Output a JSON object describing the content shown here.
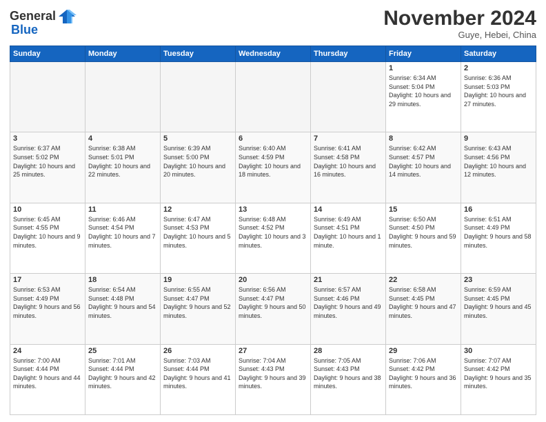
{
  "logo": {
    "general": "General",
    "blue": "Blue"
  },
  "header": {
    "month": "November 2024",
    "location": "Guye, Hebei, China"
  },
  "weekdays": [
    "Sunday",
    "Monday",
    "Tuesday",
    "Wednesday",
    "Thursday",
    "Friday",
    "Saturday"
  ],
  "weeks": [
    [
      {
        "day": "",
        "info": ""
      },
      {
        "day": "",
        "info": ""
      },
      {
        "day": "",
        "info": ""
      },
      {
        "day": "",
        "info": ""
      },
      {
        "day": "",
        "info": ""
      },
      {
        "day": "1",
        "info": "Sunrise: 6:34 AM\nSunset: 5:04 PM\nDaylight: 10 hours and 29 minutes."
      },
      {
        "day": "2",
        "info": "Sunrise: 6:36 AM\nSunset: 5:03 PM\nDaylight: 10 hours and 27 minutes."
      }
    ],
    [
      {
        "day": "3",
        "info": "Sunrise: 6:37 AM\nSunset: 5:02 PM\nDaylight: 10 hours and 25 minutes."
      },
      {
        "day": "4",
        "info": "Sunrise: 6:38 AM\nSunset: 5:01 PM\nDaylight: 10 hours and 22 minutes."
      },
      {
        "day": "5",
        "info": "Sunrise: 6:39 AM\nSunset: 5:00 PM\nDaylight: 10 hours and 20 minutes."
      },
      {
        "day": "6",
        "info": "Sunrise: 6:40 AM\nSunset: 4:59 PM\nDaylight: 10 hours and 18 minutes."
      },
      {
        "day": "7",
        "info": "Sunrise: 6:41 AM\nSunset: 4:58 PM\nDaylight: 10 hours and 16 minutes."
      },
      {
        "day": "8",
        "info": "Sunrise: 6:42 AM\nSunset: 4:57 PM\nDaylight: 10 hours and 14 minutes."
      },
      {
        "day": "9",
        "info": "Sunrise: 6:43 AM\nSunset: 4:56 PM\nDaylight: 10 hours and 12 minutes."
      }
    ],
    [
      {
        "day": "10",
        "info": "Sunrise: 6:45 AM\nSunset: 4:55 PM\nDaylight: 10 hours and 9 minutes."
      },
      {
        "day": "11",
        "info": "Sunrise: 6:46 AM\nSunset: 4:54 PM\nDaylight: 10 hours and 7 minutes."
      },
      {
        "day": "12",
        "info": "Sunrise: 6:47 AM\nSunset: 4:53 PM\nDaylight: 10 hours and 5 minutes."
      },
      {
        "day": "13",
        "info": "Sunrise: 6:48 AM\nSunset: 4:52 PM\nDaylight: 10 hours and 3 minutes."
      },
      {
        "day": "14",
        "info": "Sunrise: 6:49 AM\nSunset: 4:51 PM\nDaylight: 10 hours and 1 minute."
      },
      {
        "day": "15",
        "info": "Sunrise: 6:50 AM\nSunset: 4:50 PM\nDaylight: 9 hours and 59 minutes."
      },
      {
        "day": "16",
        "info": "Sunrise: 6:51 AM\nSunset: 4:49 PM\nDaylight: 9 hours and 58 minutes."
      }
    ],
    [
      {
        "day": "17",
        "info": "Sunrise: 6:53 AM\nSunset: 4:49 PM\nDaylight: 9 hours and 56 minutes."
      },
      {
        "day": "18",
        "info": "Sunrise: 6:54 AM\nSunset: 4:48 PM\nDaylight: 9 hours and 54 minutes."
      },
      {
        "day": "19",
        "info": "Sunrise: 6:55 AM\nSunset: 4:47 PM\nDaylight: 9 hours and 52 minutes."
      },
      {
        "day": "20",
        "info": "Sunrise: 6:56 AM\nSunset: 4:47 PM\nDaylight: 9 hours and 50 minutes."
      },
      {
        "day": "21",
        "info": "Sunrise: 6:57 AM\nSunset: 4:46 PM\nDaylight: 9 hours and 49 minutes."
      },
      {
        "day": "22",
        "info": "Sunrise: 6:58 AM\nSunset: 4:45 PM\nDaylight: 9 hours and 47 minutes."
      },
      {
        "day": "23",
        "info": "Sunrise: 6:59 AM\nSunset: 4:45 PM\nDaylight: 9 hours and 45 minutes."
      }
    ],
    [
      {
        "day": "24",
        "info": "Sunrise: 7:00 AM\nSunset: 4:44 PM\nDaylight: 9 hours and 44 minutes."
      },
      {
        "day": "25",
        "info": "Sunrise: 7:01 AM\nSunset: 4:44 PM\nDaylight: 9 hours and 42 minutes."
      },
      {
        "day": "26",
        "info": "Sunrise: 7:03 AM\nSunset: 4:44 PM\nDaylight: 9 hours and 41 minutes."
      },
      {
        "day": "27",
        "info": "Sunrise: 7:04 AM\nSunset: 4:43 PM\nDaylight: 9 hours and 39 minutes."
      },
      {
        "day": "28",
        "info": "Sunrise: 7:05 AM\nSunset: 4:43 PM\nDaylight: 9 hours and 38 minutes."
      },
      {
        "day": "29",
        "info": "Sunrise: 7:06 AM\nSunset: 4:42 PM\nDaylight: 9 hours and 36 minutes."
      },
      {
        "day": "30",
        "info": "Sunrise: 7:07 AM\nSunset: 4:42 PM\nDaylight: 9 hours and 35 minutes."
      }
    ]
  ]
}
